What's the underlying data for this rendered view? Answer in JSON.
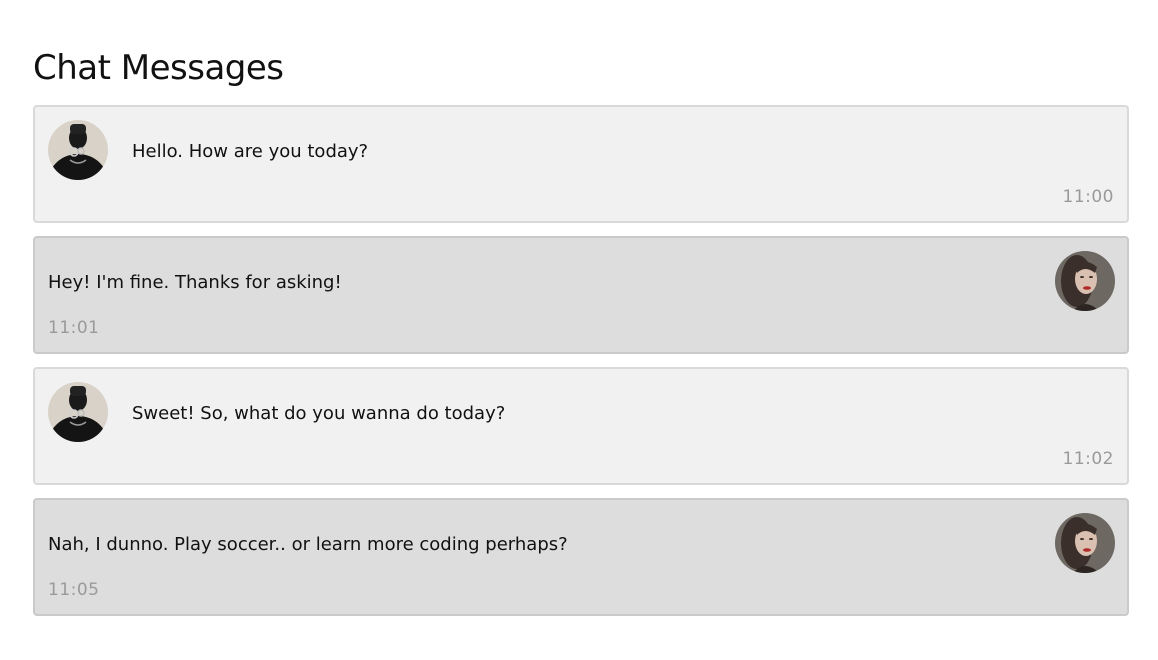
{
  "page": {
    "title": "Chat Messages"
  },
  "messages": [
    {
      "direction": "incoming",
      "avatar": "user-dark-avatar",
      "text": "Hello. How are you today?",
      "time": "11:00"
    },
    {
      "direction": "outgoing",
      "avatar": "woman-portrait-avatar",
      "text": "Hey! I'm fine. Thanks for asking!",
      "time": "11:01"
    },
    {
      "direction": "incoming",
      "avatar": "user-dark-avatar",
      "text": "Sweet! So, what do you wanna do today?",
      "time": "11:02"
    },
    {
      "direction": "outgoing",
      "avatar": "woman-portrait-avatar",
      "text": "Nah, I dunno. Play soccer.. or learn more coding perhaps?",
      "time": "11:05"
    }
  ],
  "colors": {
    "incoming_bg": "#f1f1f1",
    "outgoing_bg": "#dddddd",
    "time_text": "#9a9a9a"
  }
}
